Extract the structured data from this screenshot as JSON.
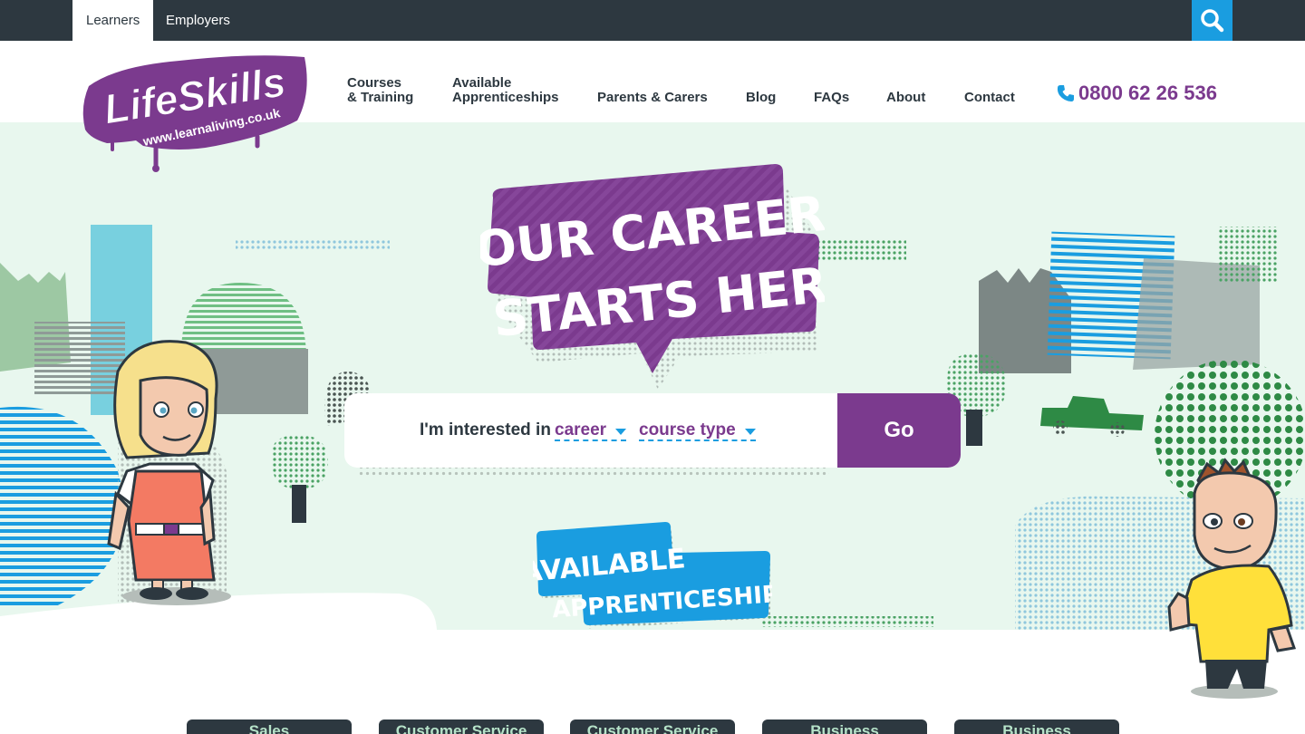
{
  "topbar": {
    "tabs": [
      {
        "label": "Learners",
        "active": true
      },
      {
        "label": "Employers",
        "active": false
      }
    ],
    "search_icon": "search-icon"
  },
  "brand": {
    "logo_text": "LifeSkills",
    "logo_url_text": "www.learnaliving.co.uk",
    "purple": "#7b3a8e",
    "blue": "#1a9de0",
    "dark": "#2d3840",
    "mint": "#e8f7ee"
  },
  "nav": {
    "courses_line1": "Courses",
    "courses_line2": "& Training",
    "apprenticeships_line1": "Available",
    "apprenticeships_line2": "Apprenticeships",
    "parents": "Parents & Carers",
    "blog": "Blog",
    "faqs": "FAQs",
    "about": "About",
    "contact": "Contact"
  },
  "phone": {
    "icon": "phone-icon",
    "number": "0800 62 26 536"
  },
  "hero": {
    "headline_line1": "YOUR CAREER",
    "headline_line2": "STARTS HERE",
    "search_prefix": "I'm interested in",
    "dropdown_career": "career",
    "dropdown_course_type": "course type",
    "go_label": "Go",
    "badge_line1": "AVAILABLE",
    "badge_line2": "APPRENTICESHIPS"
  },
  "categories": [
    {
      "label": "Sales"
    },
    {
      "label": "Customer Service"
    },
    {
      "label": "Customer Service"
    },
    {
      "label": "Business"
    },
    {
      "label": "Business"
    }
  ]
}
